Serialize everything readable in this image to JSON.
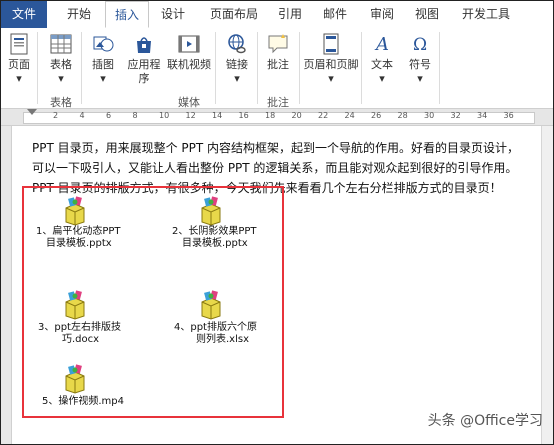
{
  "ribbon": {
    "tabs": [
      "文件",
      "开始",
      "插入",
      "设计",
      "页面布局",
      "引用",
      "邮件",
      "审阅",
      "视图",
      "开发工具"
    ],
    "active_tab": "插入",
    "buttons": {
      "page": "页面",
      "table": "表格",
      "illustration": "插图",
      "app_line1": "应用程",
      "app_line2": "序",
      "online_video": "联机视频",
      "link": "链接",
      "comment": "批注",
      "header_footer": "页眉和页脚",
      "text": "文本",
      "symbol": "符号"
    },
    "groups": {
      "tables": "表格",
      "media": "媒体",
      "comments": "批注"
    }
  },
  "ruler": {
    "numbers": [
      "2",
      "4",
      "6",
      "8",
      "10",
      "12",
      "14",
      "16",
      "18",
      "20",
      "22",
      "24",
      "26",
      "28",
      "30",
      "32",
      "34",
      "36"
    ]
  },
  "document": {
    "paragraph_lines": [
      "PPT 目录页，用来展现整个 PPT 内容结构框架，起到一个导航的作用。好看的目录页设计，",
      "可以一下吸引人，又能让人看出整份 PPT 的逻辑关系，而且能对观众起到很好的引导作用。",
      "PPT 目录页的排版方式，有很多种，今天我们先来看看几个左右分栏排版方式的目录页！"
    ],
    "attachments": [
      {
        "line1": "1、扁平化动态PPT",
        "line2": "目录模板.pptx"
      },
      {
        "line1": "2、长阴影效果PPT",
        "line2": "目录模板.pptx"
      },
      {
        "line1": "3、ppt左右排版技",
        "line2": "巧.docx"
      },
      {
        "line1": "4、ppt排版六个原",
        "line2": "则列表.xlsx"
      },
      {
        "line1": "5、操作视频.mp4",
        "line2": ""
      }
    ]
  },
  "watermark": "头条 @Office学习"
}
